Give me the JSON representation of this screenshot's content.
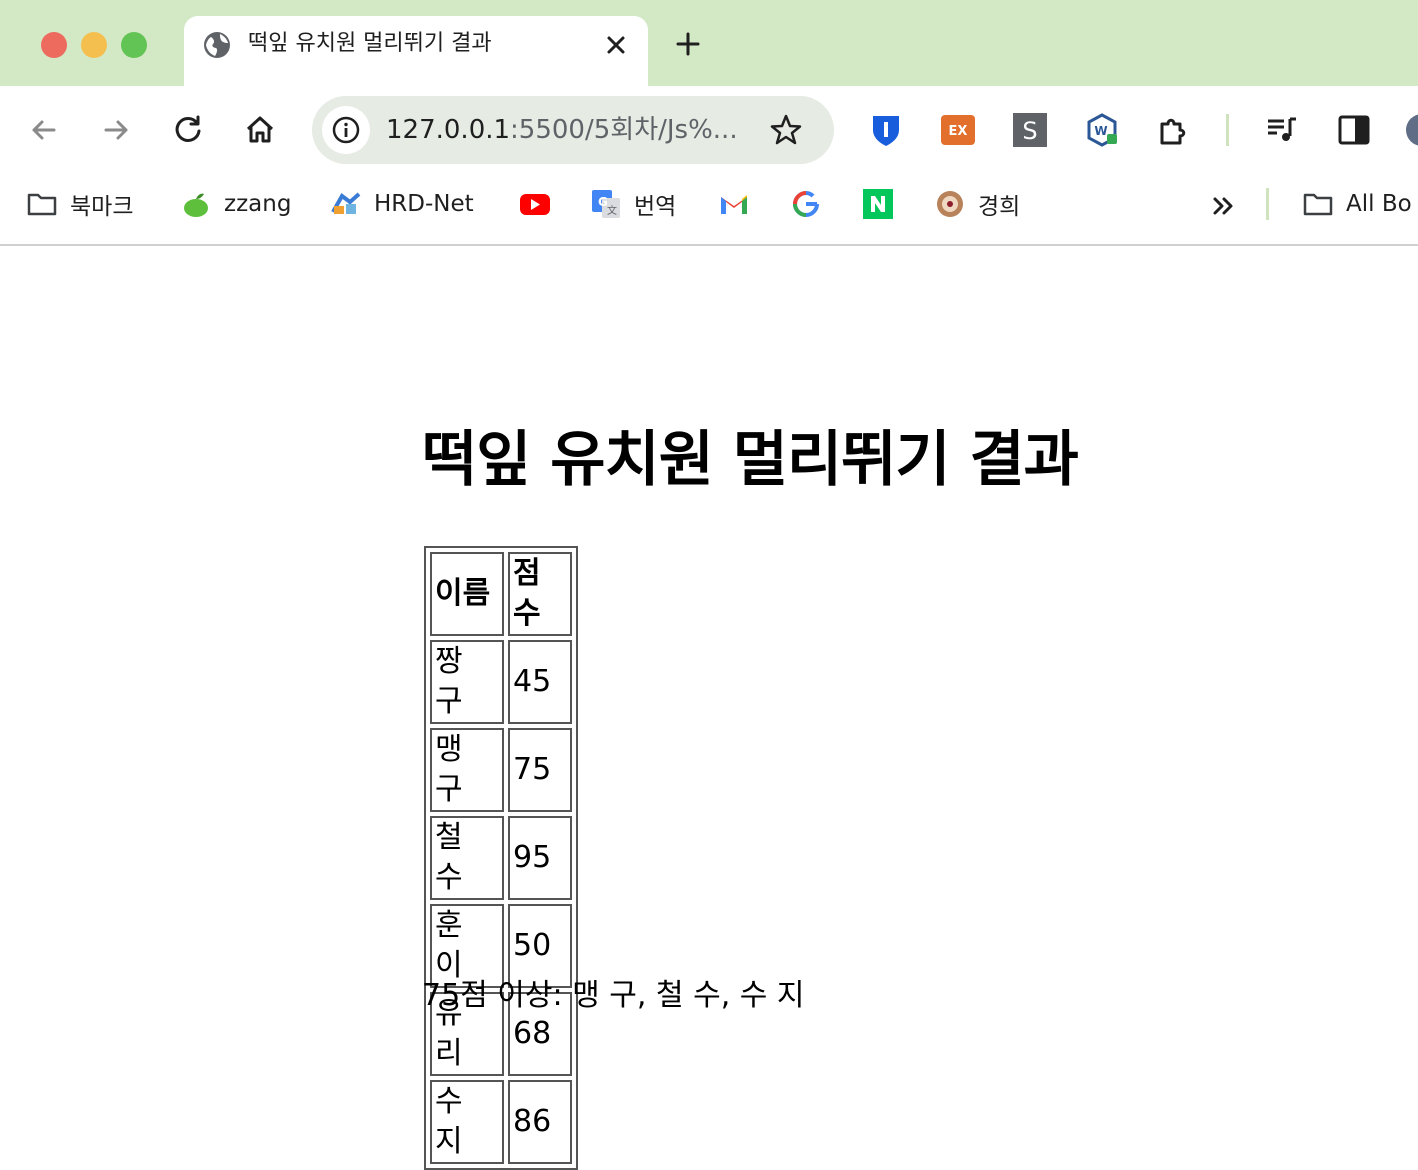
{
  "browser": {
    "tab": {
      "title": "떡잎 유치원 멀리뛰기 결과",
      "favicon": "globe-icon"
    },
    "omnibox": {
      "host": "127.0.0.1",
      "rest": ":5500/5회차/Js%..."
    },
    "bookmarks": [
      {
        "label": "북마크",
        "icon": "folder-icon"
      },
      {
        "label": "zzang",
        "icon": "apple-icon"
      },
      {
        "label": "HRD-Net",
        "icon": "hrd-net-icon"
      },
      {
        "label": "",
        "icon": "youtube-icon"
      },
      {
        "label": "번역",
        "icon": "google-translate-icon"
      },
      {
        "label": "",
        "icon": "gmail-icon"
      },
      {
        "label": "",
        "icon": "google-icon"
      },
      {
        "label": "",
        "icon": "naver-icon"
      },
      {
        "label": "경희",
        "icon": "khu-icon"
      }
    ],
    "all_bookmarks_label": "All Bo",
    "extensions": [
      "bitwarden-icon",
      "ex-icon",
      "s-icon",
      "w-icon",
      "puzzle-icon",
      "media-icon",
      "side-panel-icon",
      "profile-icon"
    ]
  },
  "page": {
    "heading": "떡잎 유치원 멀리뛰기 결과",
    "table": {
      "headers": [
        "이름",
        "점수"
      ],
      "rows": [
        {
          "name": "짱 구",
          "score": "45"
        },
        {
          "name": "맹 구",
          "score": "75"
        },
        {
          "name": "철 수",
          "score": "95"
        },
        {
          "name": "훈 이",
          "score": "50"
        },
        {
          "name": "유 리",
          "score": "68"
        },
        {
          "name": "수 지",
          "score": "86"
        }
      ]
    },
    "result": "75점 이상: 맹 구, 철 수, 수 지"
  },
  "colors": {
    "tabstrip": "#d3e8c4",
    "omnibox": "#e6ebe4",
    "traffic_red": "#ed6a5e",
    "traffic_yellow": "#f5bf4f",
    "traffic_green": "#61c454"
  }
}
